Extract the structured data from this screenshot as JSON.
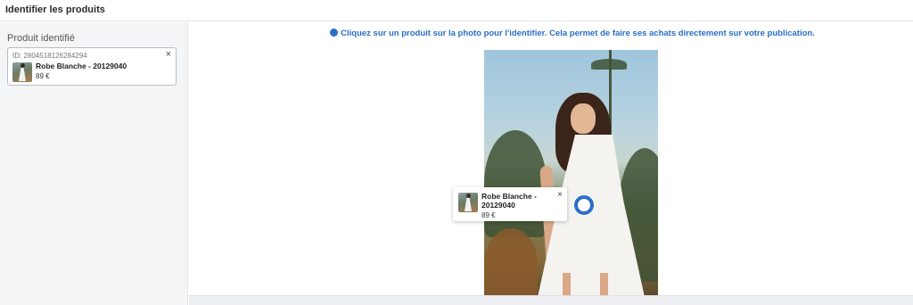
{
  "header": {
    "title": "Identifier les produits"
  },
  "sidebar": {
    "section_title": "Produit identifié",
    "product": {
      "id_label": "ID: 2804518126284294",
      "name": "Robe Blanche - 20129040",
      "price": "89 €",
      "close_label": "×"
    }
  },
  "main": {
    "hint": "Cliquez sur un produit sur la photo pour l'identifier. Cela permet de faire ses achats directement sur votre publication.",
    "tag": {
      "name": "Robe Blanche - 20129040",
      "price": "89 €",
      "close_label": "×"
    }
  },
  "colors": {
    "accent": "#2a6ec6",
    "sidebar_bg": "#f4f5f7"
  }
}
